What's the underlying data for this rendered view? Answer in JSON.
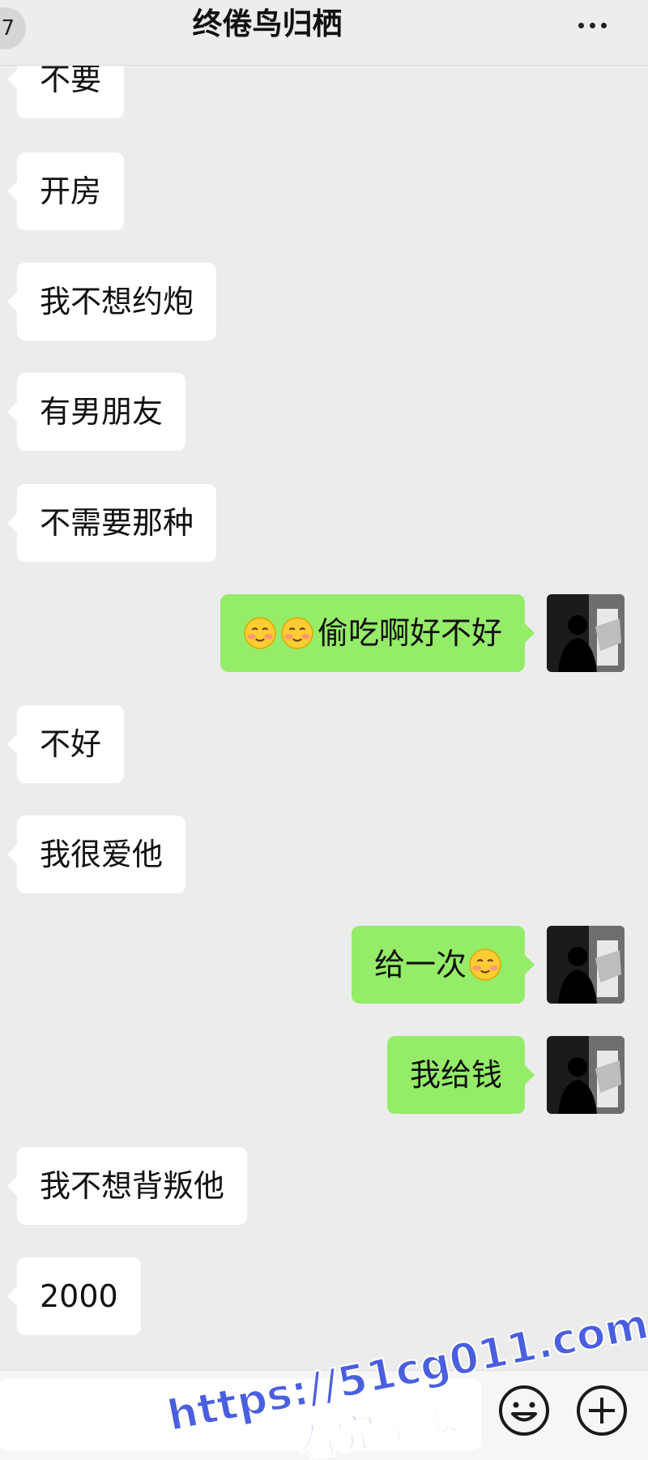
{
  "header": {
    "back_badge": "7",
    "title": "终倦鸟归栖",
    "more_icon": "more-dots-icon"
  },
  "messages": [
    {
      "side": "in",
      "text": "不要"
    },
    {
      "side": "in",
      "text": "开房"
    },
    {
      "side": "in",
      "text": "我不想约炮"
    },
    {
      "side": "in",
      "text": "有男朋友"
    },
    {
      "side": "in",
      "text": "不需要那种"
    },
    {
      "side": "out",
      "emoji_before": 2,
      "text": "偷吃啊好不好"
    },
    {
      "side": "in",
      "text": "不好"
    },
    {
      "side": "in",
      "text": "我很爱他"
    },
    {
      "side": "out",
      "text": "给一次",
      "emoji_after": 1
    },
    {
      "side": "out",
      "text": "我给钱"
    },
    {
      "side": "in",
      "text": "我不想背叛他"
    },
    {
      "side": "in",
      "text": "2000"
    }
  ],
  "input_bar": {
    "emoji_icon": "smiley-icon",
    "plus_icon": "plus-icon"
  },
  "watermark": {
    "line1": "https://51cg011.com",
    "line2": "看完整版",
    "color": "#4a5fe0"
  },
  "colors": {
    "outgoing_bubble": "#95ec69",
    "incoming_bubble": "#ffffff",
    "background": "#ececec"
  }
}
